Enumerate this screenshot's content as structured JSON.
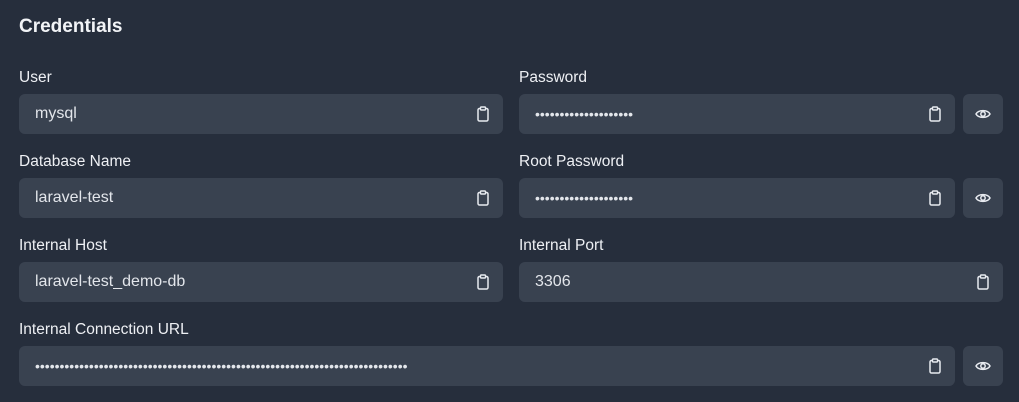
{
  "section": {
    "title": "Credentials"
  },
  "fields": {
    "user": {
      "label": "User",
      "value": "mysql"
    },
    "password": {
      "label": "Password",
      "value": "••••••••••••••••••••"
    },
    "database_name": {
      "label": "Database Name",
      "value": "laravel-test"
    },
    "root_password": {
      "label": "Root Password",
      "value": "••••••••••••••••••••"
    },
    "internal_host": {
      "label": "Internal Host",
      "value": "laravel-test_demo-db"
    },
    "internal_port": {
      "label": "Internal Port",
      "value": "3306"
    },
    "internal_connection_url": {
      "label": "Internal Connection URL",
      "value": "••••••••••••••••••••••••••••••••••••••••••••••••••••••••••••••••••••••••••••"
    }
  },
  "icons": {
    "copy": "clipboard-icon",
    "reveal": "eye-icon"
  },
  "colors": {
    "background": "#262e3c",
    "field": "#394250"
  }
}
